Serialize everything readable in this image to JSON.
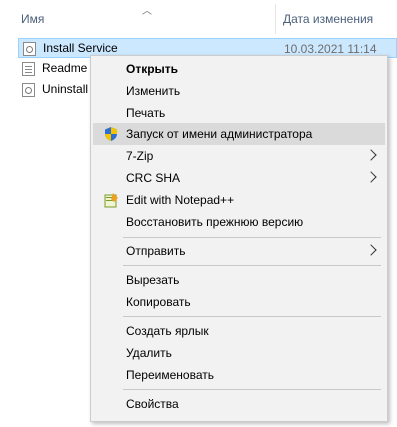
{
  "columns": {
    "name": "Имя",
    "date_modified": "Дата изменения"
  },
  "files": [
    {
      "name": "Install Service",
      "date": "10.03.2021 11:14",
      "icon": "script-icon",
      "selected": true
    },
    {
      "name": "Readme",
      "icon": "text-document-icon"
    },
    {
      "name": "Uninstall",
      "icon": "script-icon"
    }
  ],
  "menu": {
    "open": "Открыть",
    "edit": "Изменить",
    "print": "Печать",
    "run_as_admin": "Запуск от имени администратора",
    "zip": "7-Zip",
    "crc_sha": "CRC SHA",
    "notepadpp": "Edit with Notepad++",
    "restore_previous": "Восстановить прежнюю версию",
    "send_to": "Отправить",
    "cut": "Вырезать",
    "copy": "Копировать",
    "create_shortcut": "Создать ярлык",
    "delete": "Удалить",
    "rename": "Переименовать",
    "properties": "Свойства"
  },
  "colors": {
    "selection_bg": "#cce8ff",
    "menu_bg": "#f2f2f2",
    "menu_hover": "#dadada",
    "uac_blue": "#2c6fd1",
    "uac_yellow": "#f5c400"
  }
}
